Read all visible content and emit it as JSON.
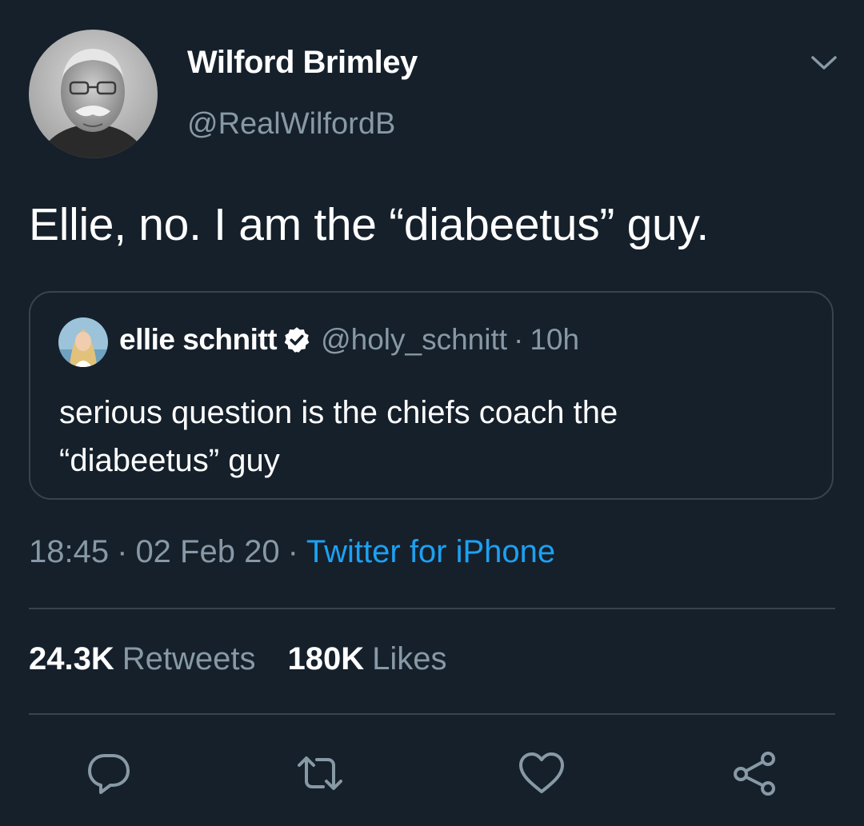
{
  "tweet": {
    "author_name": "Wilford Brimley",
    "author_handle": "@RealWilfordB",
    "text": "Ellie, no. I am the “diabeetus” guy.",
    "menu_icon": "chevron-down-icon"
  },
  "quoted_tweet": {
    "author_name": "ellie schnitt",
    "verified_icon": "verified-badge-icon",
    "author_handle": "@holy_schnitt",
    "separator": "·",
    "time": "10h",
    "text": "serious question is the chiefs coach the “diabeetus” guy"
  },
  "meta": {
    "time": "18:45",
    "separator": "·",
    "date": "02 Feb 20",
    "source": "Twitter for iPhone"
  },
  "stats": {
    "retweets_count": "24.3K",
    "retweets_label": "Retweets",
    "likes_count": "180K",
    "likes_label": "Likes"
  },
  "actions": {
    "reply_icon": "reply-icon",
    "retweet_icon": "retweet-icon",
    "like_icon": "heart-icon",
    "share_icon": "share-icon"
  },
  "colors": {
    "background": "#15202b",
    "primary_text": "#ffffff",
    "secondary_text": "#8899a6",
    "accent": "#1da1f2",
    "border": "#38444d"
  }
}
